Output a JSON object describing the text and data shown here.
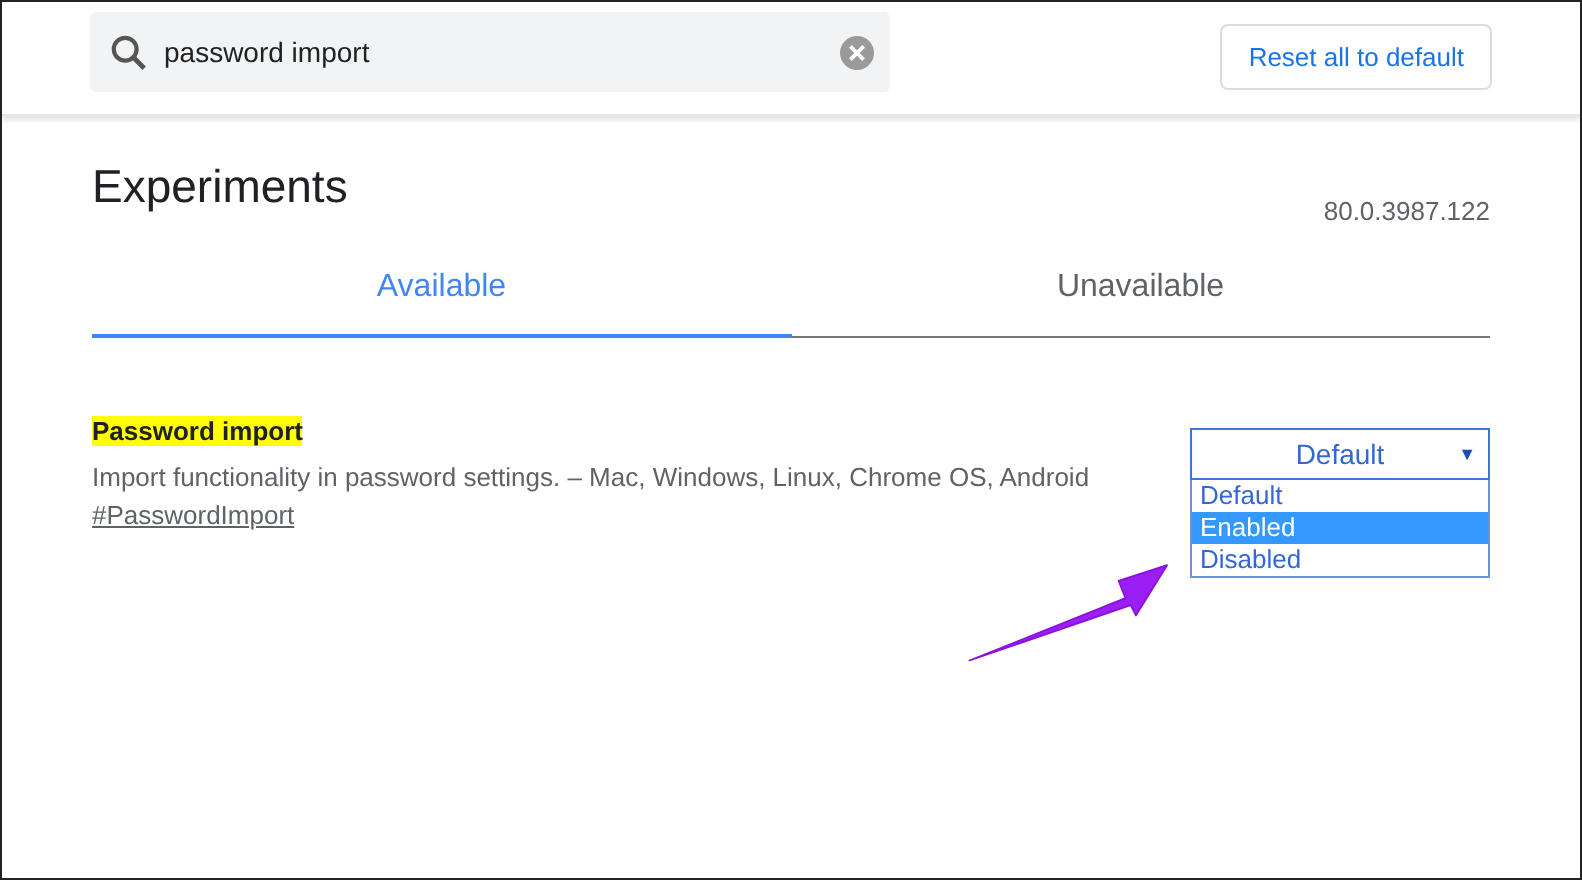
{
  "search": {
    "value": "password import"
  },
  "reset_button": "Reset all to default",
  "title": "Experiments",
  "version": "80.0.3987.122",
  "tabs": [
    {
      "label": "Available",
      "selected": true
    },
    {
      "label": "Unavailable",
      "selected": false
    }
  ],
  "experiments": [
    {
      "name": "Password import",
      "matched": true,
      "description": "Import functionality in password settings. – Mac, Windows, Linux, Chrome OS, Android",
      "link": "#PasswordImport",
      "dropdown": {
        "value": "Default",
        "caret": "▼",
        "expanded": true,
        "options": [
          {
            "label": "Default",
            "highlighted": false
          },
          {
            "label": "Enabled",
            "highlighted": true
          },
          {
            "label": "Disabled",
            "highlighted": false
          }
        ]
      }
    }
  ]
}
